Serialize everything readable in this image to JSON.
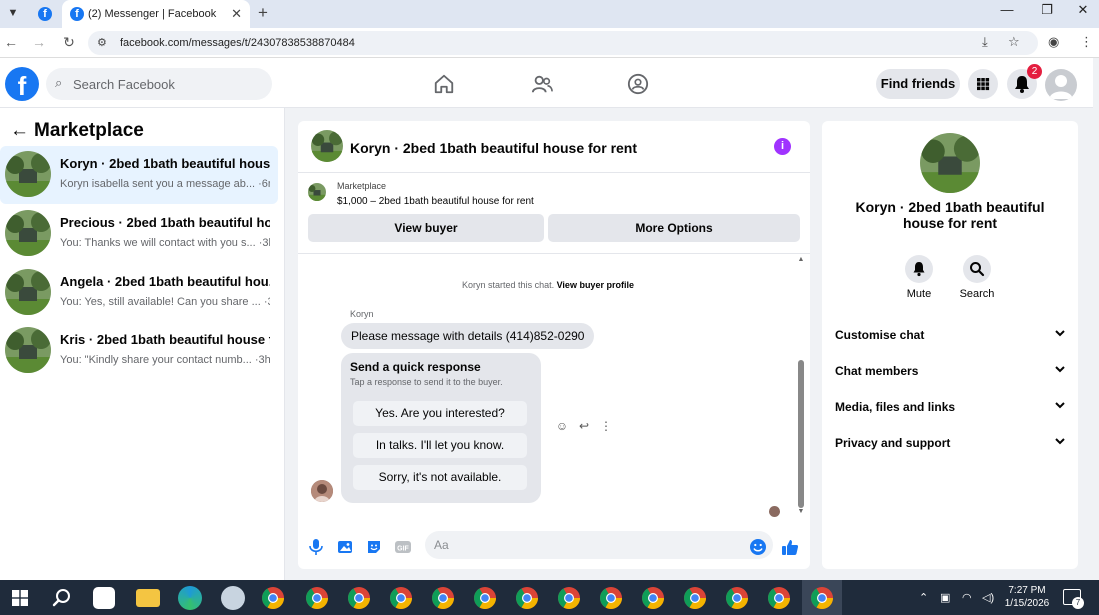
{
  "browser": {
    "active_tab_title": "(2) Messenger | Facebook",
    "url": "facebook.com/messages/t/24307838538870484",
    "tab_close": "✕",
    "new_tab": "+"
  },
  "fb_header": {
    "logo": "f",
    "search_placeholder": "Search Facebook",
    "find_friends_label": "Find friends",
    "notification_count": "2"
  },
  "left_panel": {
    "heading": "Marketplace",
    "conversations": [
      {
        "title": "Koryn · 2bed 1bath beautiful hous...",
        "preview": "Koryn isabella sent you a message ab... ·6m"
      },
      {
        "title": "Precious · 2bed 1bath beautiful ho...",
        "preview": "You: Thanks we will contact with you s... ·3h"
      },
      {
        "title": "Angela · 2bed 1bath beautiful hou...",
        "preview": "You: Yes, still available! Can you share ... ·3h"
      },
      {
        "title": "Kris · 2bed 1bath beautiful house f...",
        "preview": "You: \"Kindly share your contact numb... ·3h"
      }
    ]
  },
  "chat": {
    "title": "Koryn · 2bed 1bath beautiful house for rent",
    "marketplace_label": "Marketplace",
    "listing": "$1,000 – 2bed 1bath beautiful house for rent",
    "view_buyer_label": "View buyer",
    "more_options_label": "More Options",
    "started_text": "Koryn started this chat.",
    "view_profile_link": "View buyer profile",
    "sender_name": "Koryn",
    "message": "Please message with details (414)852-0290",
    "quick_response": {
      "title": "Send a quick response",
      "subtitle": "Tap a response to send it to the buyer.",
      "options": [
        "Yes. Are you interested?",
        "In talks. I'll let you know.",
        "Sorry, it's not available."
      ]
    },
    "input_placeholder": "Aa"
  },
  "right_panel": {
    "title": "Koryn · 2bed 1bath beautiful house for rent",
    "mute_label": "Mute",
    "search_label": "Search",
    "sections": [
      "Customise chat",
      "Chat members",
      "Media, files and links",
      "Privacy and support"
    ]
  },
  "taskbar": {
    "time": "7:27 PM",
    "date": "1/15/2026",
    "notification_count": "7"
  },
  "colors": {
    "fb_blue": "#1877f2",
    "badge_red": "#e41e3f",
    "info_purple": "#a033ff",
    "taskbar_bg": "#1f2b3b"
  }
}
